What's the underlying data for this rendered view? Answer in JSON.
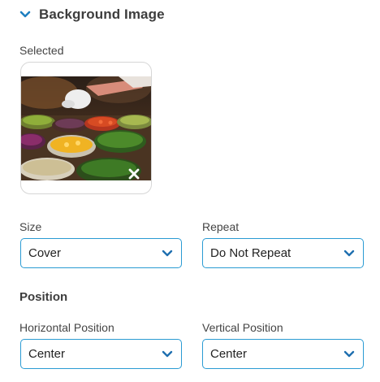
{
  "section": {
    "title": "Background Image",
    "icon": "chevron-down-icon",
    "accent": "#1f7fc0"
  },
  "selected": {
    "label": "Selected",
    "remove_icon": "close-icon"
  },
  "size": {
    "label": "Size",
    "value": "Cover"
  },
  "repeat": {
    "label": "Repeat",
    "value": "Do Not Repeat"
  },
  "position": {
    "heading": "Position",
    "horizontal": {
      "label": "Horizontal Position",
      "value": "Center"
    },
    "vertical": {
      "label": "Vertical Position",
      "value": "Center"
    }
  },
  "colors": {
    "field_border": "#2a9bd3",
    "caret": "#1f6fb0"
  }
}
